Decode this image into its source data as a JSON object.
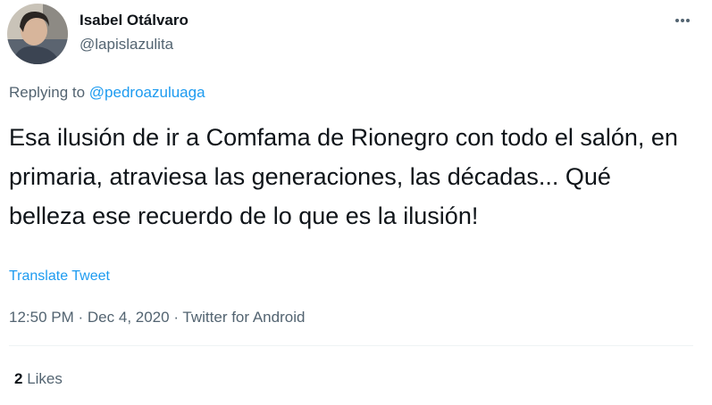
{
  "author": {
    "name": "Isabel Otálvaro",
    "handle": "@lapislazulita"
  },
  "menu": {
    "icon": "more-dots-icon"
  },
  "reply": {
    "prefix": "Replying to",
    "to": "@pedroazuluaga"
  },
  "tweet": {
    "text": "Esa ilusión de ir a Comfama de Rionegro con todo el salón, en primaria, atraviesa las generaciones, las décadas... Qué belleza ese recuerdo de lo que es la ilusión!",
    "translate_label": "Translate Tweet"
  },
  "meta": {
    "time": "12:50 PM",
    "separator": "·",
    "date": "Dec 4, 2020",
    "source": "Twitter for Android"
  },
  "stats": {
    "likes_count": "2",
    "likes_label": "Likes"
  },
  "colors": {
    "accent": "#1d9bf0",
    "secondary_text": "#536471",
    "primary_text": "#0f1419"
  }
}
